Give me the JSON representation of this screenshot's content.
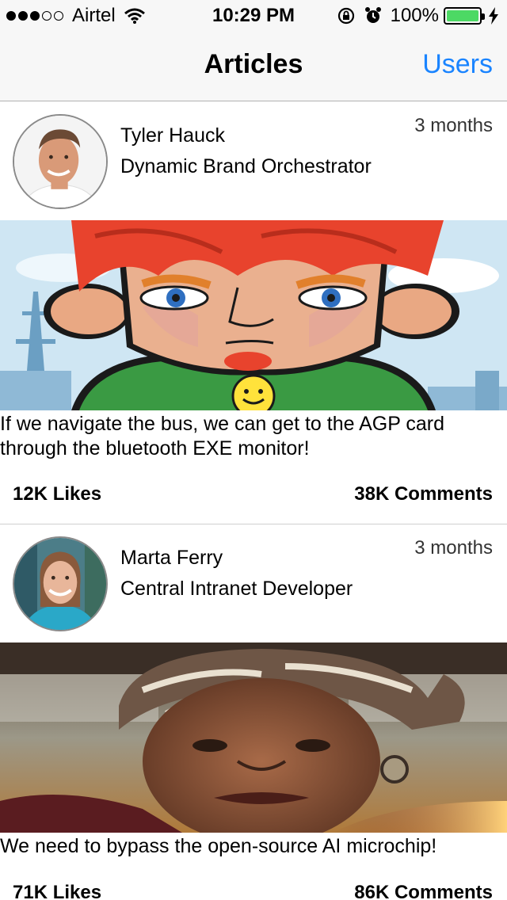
{
  "status_bar": {
    "carrier": "Airtel",
    "time": "10:29 PM",
    "battery_percent": "100%",
    "signal_bars_filled": 3,
    "signal_bars_total": 5,
    "battery_level": 1.0,
    "battery_color": "#4cd964"
  },
  "nav": {
    "title": "Articles",
    "right_button": "Users",
    "accent_color": "#1a84ff"
  },
  "articles": [
    {
      "author_name": "Tyler Hauck",
      "author_title": "Dynamic Brand Orchestrator",
      "time_ago": "3 months",
      "body": "If we navigate the bus, we can get to the AGP card through the bluetooth EXE monitor!",
      "likes": "12K Likes",
      "comments": "38K Comments",
      "image_icon": "cartoon-boy-image"
    },
    {
      "author_name": "Marta Ferry",
      "author_title": "Central Intranet Developer",
      "time_ago": "3 months",
      "body": "We need to bypass the open-source AI microchip!",
      "likes": "71K Likes",
      "comments": "86K Comments",
      "image_icon": "woman-headwrap-photo"
    }
  ]
}
